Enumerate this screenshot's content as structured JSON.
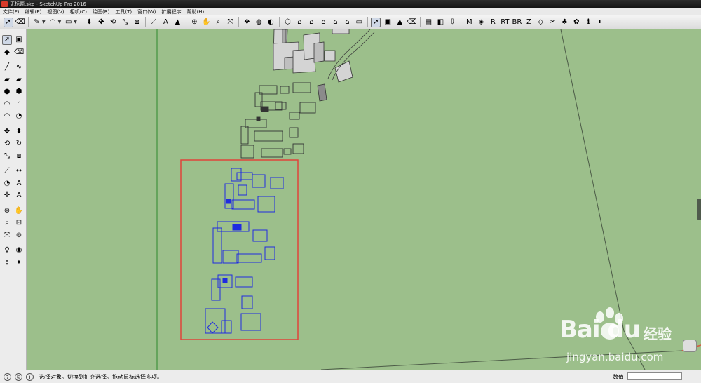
{
  "window": {
    "title": "无标题.skp - SketchUp Pro 2016"
  },
  "menu": [
    "文件(F)",
    "编辑(E)",
    "视图(V)",
    "相机(C)",
    "绘图(R)",
    "工具(T)",
    "窗口(W)",
    "扩展程序",
    "帮助(H)"
  ],
  "toolbar": {
    "groups": [
      [
        {
          "name": "select-icon",
          "g": "➚",
          "active": true
        },
        {
          "name": "eraser-icon",
          "g": "⌫"
        }
      ],
      [
        {
          "name": "pencil-icon",
          "g": "✎",
          "drop": true
        },
        {
          "name": "arc-icon",
          "g": "◠",
          "drop": true
        },
        {
          "name": "rectangle-icon",
          "g": "▭",
          "drop": true
        }
      ],
      [
        {
          "name": "push-pull-icon",
          "g": "⬍"
        },
        {
          "name": "move-icon",
          "g": "✥"
        },
        {
          "name": "rotate-icon",
          "g": "⟲"
        },
        {
          "name": "scale-icon",
          "g": "⤡"
        },
        {
          "name": "offset-icon",
          "g": "⧈"
        }
      ],
      [
        {
          "name": "tape-measure-icon",
          "g": "⟋"
        },
        {
          "name": "text-icon",
          "g": "A"
        },
        {
          "name": "paint-bucket-icon",
          "g": "▲"
        }
      ],
      [
        {
          "name": "orbit-icon",
          "g": "⊛"
        },
        {
          "name": "pan-icon",
          "g": "✋"
        },
        {
          "name": "zoom-icon",
          "g": "⌕"
        },
        {
          "name": "zoom-extents-icon",
          "g": "⤧"
        }
      ],
      [
        {
          "name": "components-icon",
          "g": "❖"
        },
        {
          "name": "styles-icon",
          "g": "◍"
        },
        {
          "name": "shadows-icon",
          "g": "◐"
        }
      ],
      [
        {
          "name": "iso-view-icon",
          "g": "⬡"
        },
        {
          "name": "top-view-icon",
          "g": "⌂"
        },
        {
          "name": "front-view-icon",
          "g": "⌂"
        },
        {
          "name": "right-view-icon",
          "g": "⌂"
        },
        {
          "name": "back-view-icon",
          "g": "⌂"
        },
        {
          "name": "left-view-icon",
          "g": "⌂"
        },
        {
          "name": "bottom-view-icon",
          "g": "▭"
        }
      ],
      [
        {
          "name": "select-icon-2",
          "g": "➚",
          "active": true
        },
        {
          "name": "make-component-icon",
          "g": "▣"
        },
        {
          "name": "paint-icon-2",
          "g": "▲"
        },
        {
          "name": "eraser-icon-2",
          "g": "⌫"
        }
      ],
      [
        {
          "name": "layers-icon",
          "g": "▤"
        },
        {
          "name": "section-plane-icon",
          "g": "◧"
        },
        {
          "name": "import-icon",
          "g": "⇩"
        }
      ],
      [
        {
          "name": "plugin-m-icon",
          "g": "M"
        },
        {
          "name": "plugin-tag-icon",
          "g": "◈"
        },
        {
          "name": "plugin-r-icon",
          "g": "R"
        },
        {
          "name": "plugin-rt-icon",
          "g": "RT"
        },
        {
          "name": "plugin-br-icon",
          "g": "BR"
        },
        {
          "name": "plugin-z-icon",
          "g": "Z"
        },
        {
          "name": "plugin-label-icon",
          "g": "◇"
        },
        {
          "name": "plugin-tool-icon",
          "g": "✂"
        },
        {
          "name": "plugin-tree-icon",
          "g": "♣"
        },
        {
          "name": "plugin-flower-icon",
          "g": "✿"
        },
        {
          "name": "plugin-info-icon",
          "g": "ℹ"
        },
        {
          "name": "plugin-pause-icon",
          "g": "⏸"
        }
      ]
    ]
  },
  "left_tools": [
    [
      {
        "name": "select-tool-icon",
        "g": "➚",
        "active": true
      },
      {
        "name": "make-component-tool-icon",
        "g": "▣"
      }
    ],
    [
      {
        "name": "paint-bucket-tool-icon",
        "g": "◆"
      },
      {
        "name": "eraser-tool-icon",
        "g": "⌫"
      }
    ],
    [
      {
        "name": "line-tool-icon",
        "g": "╱",
        "gap": true
      },
      {
        "name": "freehand-tool-icon",
        "g": "∿"
      }
    ],
    [
      {
        "name": "rectangle-tool-icon",
        "g": "▰"
      },
      {
        "name": "rotated-rectangle-tool-icon",
        "g": "▰"
      }
    ],
    [
      {
        "name": "circle-tool-icon",
        "g": "●"
      },
      {
        "name": "polygon-tool-icon",
        "g": "⬢"
      }
    ],
    [
      {
        "name": "arc-tool-icon",
        "g": "◠"
      },
      {
        "name": "two-point-arc-tool-icon",
        "g": "◜"
      }
    ],
    [
      {
        "name": "three-point-arc-tool-icon",
        "g": "◠"
      },
      {
        "name": "pie-tool-icon",
        "g": "◔"
      }
    ],
    [
      {
        "name": "move-tool-icon",
        "g": "✥",
        "gap": true
      },
      {
        "name": "push-pull-tool-icon",
        "g": "⬍"
      }
    ],
    [
      {
        "name": "rotate-tool-icon",
        "g": "⟲"
      },
      {
        "name": "follow-me-tool-icon",
        "g": "↻"
      }
    ],
    [
      {
        "name": "scale-tool-icon",
        "g": "⤡"
      },
      {
        "name": "offset-tool-icon",
        "g": "⧈"
      }
    ],
    [
      {
        "name": "tape-measure-tool-icon",
        "g": "⟋",
        "gap": true
      },
      {
        "name": "dimension-tool-icon",
        "g": "↔"
      }
    ],
    [
      {
        "name": "protractor-tool-icon",
        "g": "◔"
      },
      {
        "name": "text-tool-icon",
        "g": "A"
      }
    ],
    [
      {
        "name": "axes-tool-icon",
        "g": "✛"
      },
      {
        "name": "3d-text-tool-icon",
        "g": "A"
      }
    ],
    [
      {
        "name": "orbit-tool-icon",
        "g": "⊛",
        "gap": true
      },
      {
        "name": "pan-tool-icon",
        "g": "✋"
      }
    ],
    [
      {
        "name": "zoom-tool-icon",
        "g": "⌕"
      },
      {
        "name": "zoom-window-tool-icon",
        "g": "⊡"
      }
    ],
    [
      {
        "name": "zoom-extents-tool-icon",
        "g": "⤧"
      },
      {
        "name": "previous-view-tool-icon",
        "g": "⊙"
      }
    ],
    [
      {
        "name": "position-camera-tool-icon",
        "g": "♀",
        "gap": true
      },
      {
        "name": "look-around-tool-icon",
        "g": "◉"
      }
    ],
    [
      {
        "name": "walk-tool-icon",
        "g": "⦂"
      },
      {
        "name": "section-plane-tool-icon",
        "g": "✦"
      }
    ]
  ],
  "status": {
    "message": "选择对象。切换到扩充选择。拖动鼠标选择多项。",
    "measurement_label": "数值",
    "measurement_value": ""
  },
  "watermark": {
    "logo": "Bai du",
    "cn": "经验",
    "url": "jingyan.baidu.com"
  },
  "colors": {
    "ground": "#9cbf8b",
    "selection_outline": "#1f2be0",
    "selection_box": "#e0443a",
    "edges": "#3a3a3a",
    "green_axis": "#2e8a2e"
  }
}
